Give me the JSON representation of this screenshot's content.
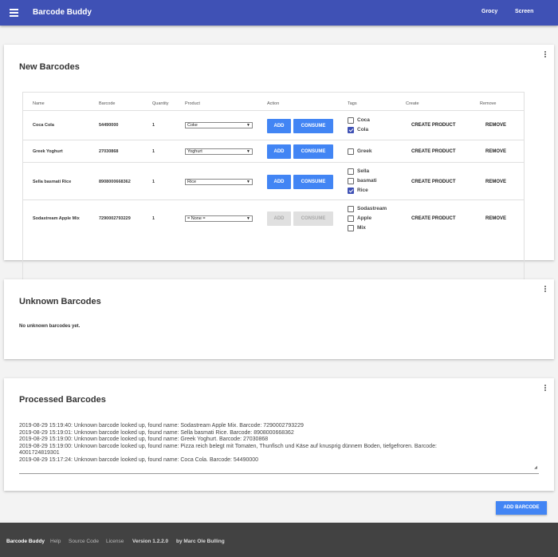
{
  "header": {
    "title": "Barcode Buddy",
    "nav": [
      "Grocy",
      "Screen"
    ],
    "bg_color": "#3f51b5"
  },
  "new_barcodes": {
    "title": "New Barcodes",
    "columns": [
      "Name",
      "Barcode",
      "Quantity",
      "Product",
      "Action",
      "Tags",
      "Create",
      "Remove"
    ],
    "rows": [
      {
        "name": "Coca Cola",
        "barcode": "54490000",
        "quantity": "1",
        "product": "Coke",
        "add": "ADD",
        "consume": "CONSUME",
        "enabled": true,
        "tags": [
          {
            "label": "Coca",
            "checked": false
          },
          {
            "label": "Cola",
            "checked": true
          }
        ],
        "create": "CREATE PRODUCT",
        "remove": "REMOVE"
      },
      {
        "name": "Greek Yoghurt",
        "barcode": "27030868",
        "quantity": "1",
        "product": "Yoghurt",
        "add": "ADD",
        "consume": "CONSUME",
        "enabled": true,
        "tags": [
          {
            "label": "Greek",
            "checked": false
          }
        ],
        "create": "CREATE PRODUCT",
        "remove": "REMOVE"
      },
      {
        "name": "Sella basmati Rice",
        "barcode": "8908000668362",
        "quantity": "1",
        "product": "Rice",
        "add": "ADD",
        "consume": "CONSUME",
        "enabled": true,
        "tags": [
          {
            "label": "Sella",
            "checked": false
          },
          {
            "label": "basmati",
            "checked": false
          },
          {
            "label": "Rice",
            "checked": true
          }
        ],
        "create": "CREATE PRODUCT",
        "remove": "REMOVE"
      },
      {
        "name": "Sodastream Apple Mix",
        "barcode": "7290002793229",
        "quantity": "1",
        "product": "= None =",
        "add": "ADD",
        "consume": "CONSUME",
        "enabled": false,
        "tags": [
          {
            "label": "Sodastream",
            "checked": false
          },
          {
            "label": "Apple",
            "checked": false
          },
          {
            "label": "Mix",
            "checked": false
          }
        ],
        "create": "CREATE PRODUCT",
        "remove": "REMOVE"
      }
    ]
  },
  "unknown_barcodes": {
    "title": "Unknown Barcodes",
    "empty_text": "No unknown barcodes yet."
  },
  "processed_barcodes": {
    "title": "Processed Barcodes",
    "log": [
      "2019-08-29 15:19:40: Unknown barcode looked up, found name: Sodastream Apple Mix. Barcode: 7290002793229",
      "2019-08-29 15:19:01: Unknown barcode looked up, found name: Sella basmati Rice. Barcode: 8908000668362",
      "2019-08-29 15:19:00: Unknown barcode looked up, found name: Greek Yoghurt. Barcode: 27030868",
      "2019-08-29 15:19:00: Unknown barcode looked up, found name: Pizza reich belegt mit Tomaten, Thunfisch und Käse auf knusprig dünnem Boden, tiefgefroren. Barcode:",
      "4001724819301",
      "2019-08-29 15:17:24: Unknown barcode looked up, found name: Coca Cola. Barcode: 54490000"
    ]
  },
  "fab_label": "ADD BARCODE",
  "footer": {
    "app": "Barcode Buddy",
    "help": "Help",
    "source": "Source Code",
    "license": "License",
    "version": "Version 1.2.2.0",
    "author": "by Marc Ole Bulling"
  }
}
